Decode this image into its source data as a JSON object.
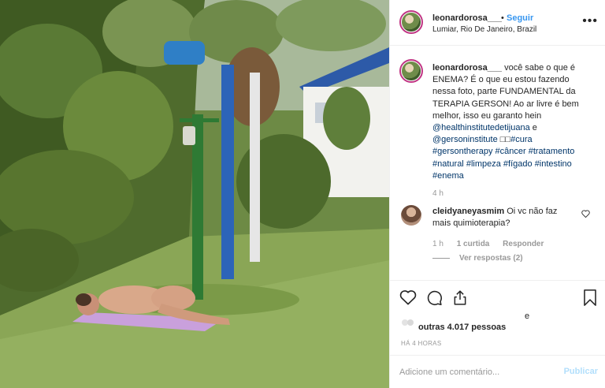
{
  "post": {
    "username": "leonardorosa___",
    "follow_label": "Seguir",
    "follow_separator": "•",
    "location": "Lumiar, Rio De Janeiro, Brazil",
    "more_label": "•••"
  },
  "caption": {
    "username": "leonardorosa___",
    "text_main": "você sabe o que é ENEMA? É o que eu estou fazendo nessa foto, parte FUNDAMENTAL da TERAPIA GERSON! Ao ar livre é bem melhor, isso eu garanto hein",
    "mention1": "@healthinstitutedetijuana",
    "and": "e",
    "mention2": "@gersoninstitute",
    "emoji": "□□",
    "tags": [
      "#cura",
      "#gersontherapy",
      "#câncer",
      "#tratamento",
      "#natural",
      "#limpeza",
      "#fígado",
      "#intestino",
      "#enema"
    ],
    "time": "4 h"
  },
  "comment": {
    "username": "cleidyaneyasmim",
    "text": "Oi vc não faz mais quimioterapia?",
    "time": "1 h",
    "likes": "1 curtida",
    "reply_label": "Responder",
    "view_replies": "Ver respostas (2)"
  },
  "likes": {
    "e": "e",
    "others": "outras 4.017 pessoas"
  },
  "time_ago": "HÁ 4 HORAS",
  "add_comment": {
    "placeholder": "Adicione um comentário...",
    "publish_label": "Publicar"
  },
  "colors": {
    "link": "#3897f0",
    "hashtag": "#003569",
    "muted": "#999999",
    "publish_disabled": "#b2dffc"
  },
  "icons": [
    "heart-icon",
    "comment-icon",
    "share-icon",
    "bookmark-icon",
    "more-options-icon",
    "small-heart-icon"
  ]
}
